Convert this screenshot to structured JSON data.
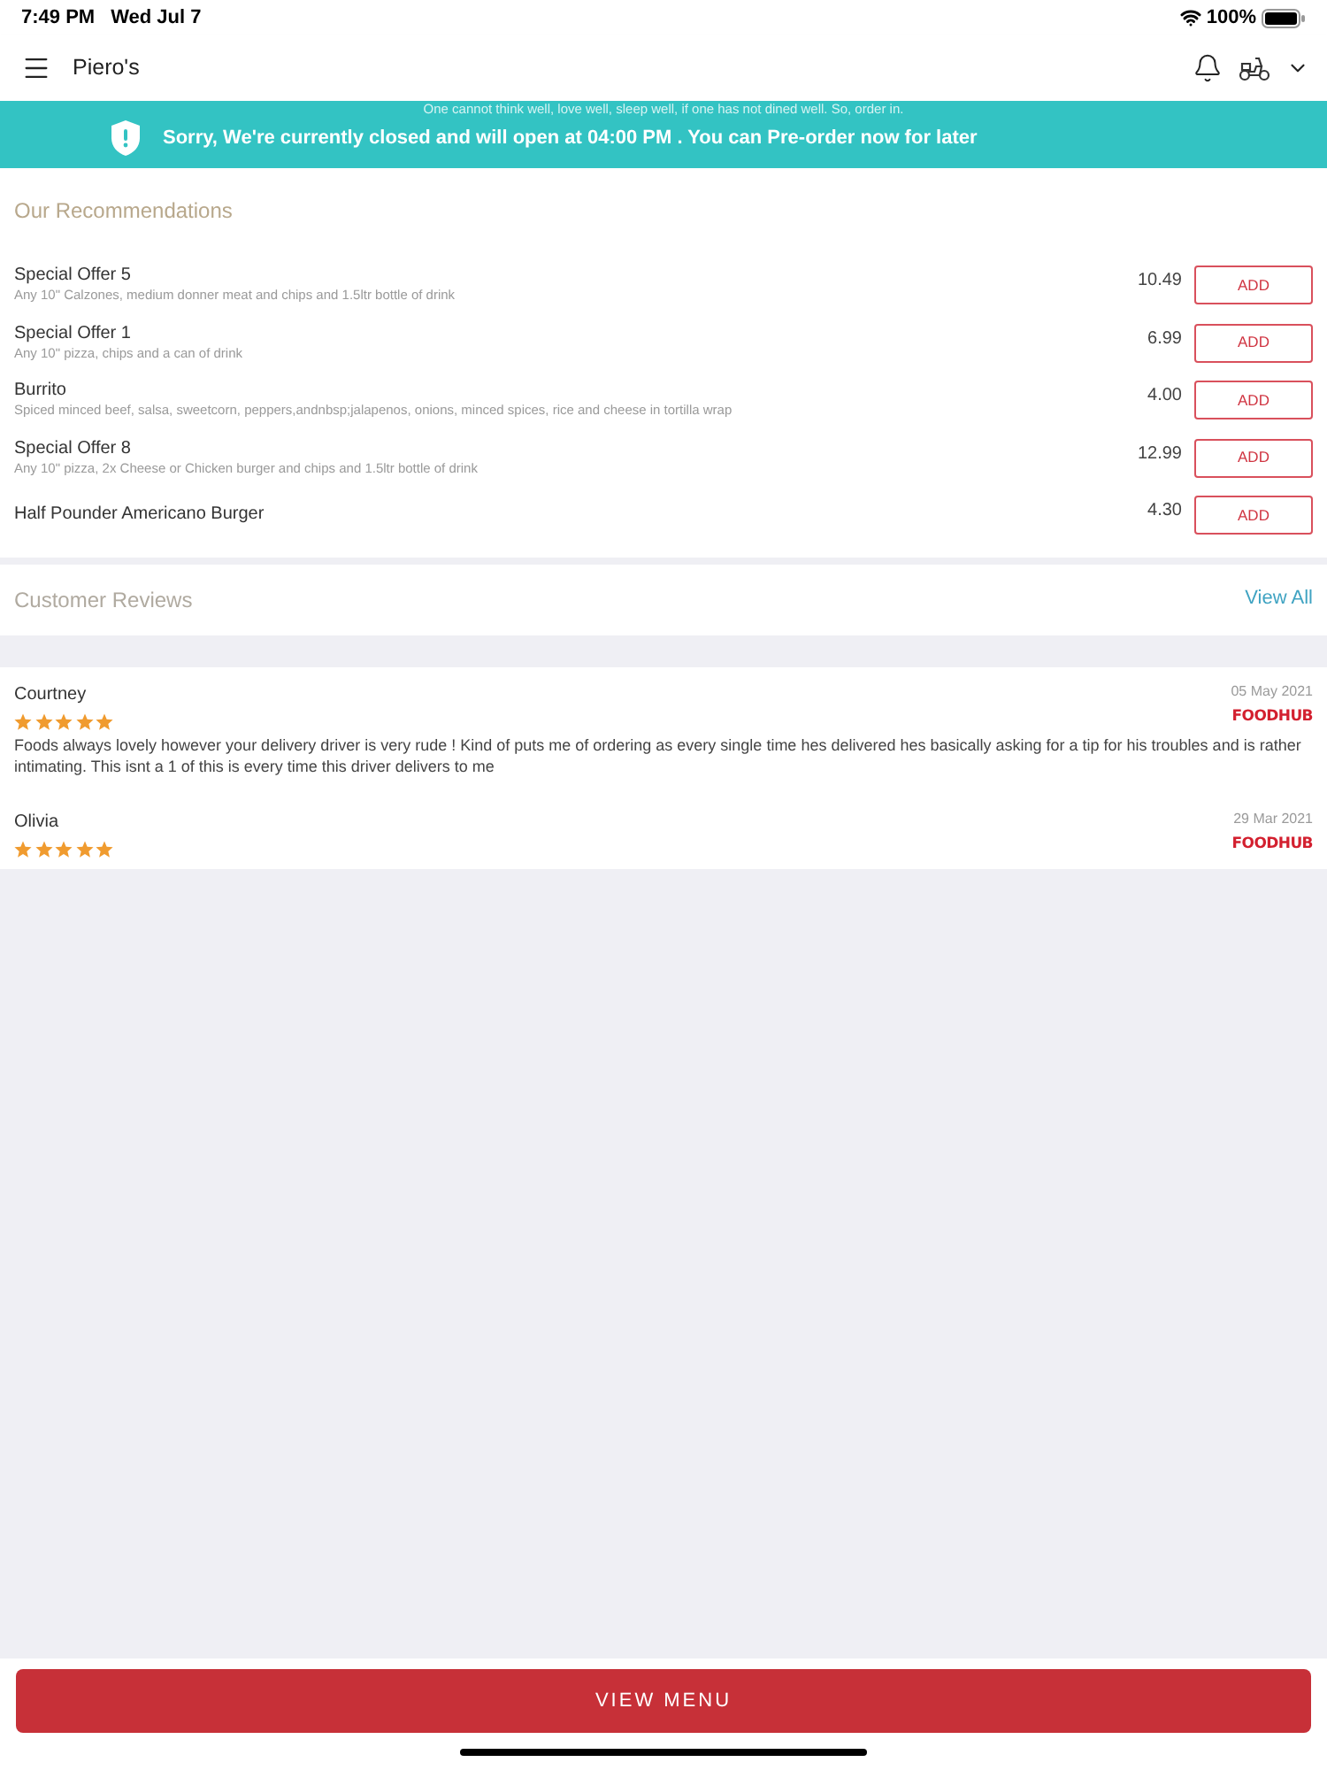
{
  "status_bar": {
    "time": "7:49 PM",
    "date": "Wed Jul 7",
    "battery": "100%"
  },
  "header": {
    "title": "Piero's"
  },
  "banner": {
    "tagline": "One cannot think well, love well, sleep well, if one has not dined well. So, order in.",
    "message": "Sorry, We're currently closed and will open at 04:00 PM . You can Pre-order now for later"
  },
  "recommendations": {
    "title": "Our Recommendations",
    "items": [
      {
        "name": "Special Offer 5",
        "description": "Any 10\" Calzones, medium donner meat and chips and 1.5ltr bottle of drink",
        "price": "10.49",
        "button": "ADD"
      },
      {
        "name": "Special Offer 1",
        "description": "Any 10\" pizza, chips and a can of drink",
        "price": "6.99",
        "button": "ADD"
      },
      {
        "name": "Burrito",
        "description": "Spiced minced beef, salsa, sweetcorn, peppers,andnbsp;jalapenos, onions, minced spices, rice and cheese in tortilla wrap",
        "price": "4.00",
        "button": "ADD"
      },
      {
        "name": "Special Offer 8",
        "description": "Any 10\" pizza, 2x Cheese or Chicken burger and chips and 1.5ltr bottle of drink",
        "price": "12.99",
        "button": "ADD"
      },
      {
        "name": "Half Pounder Americano Burger",
        "price": "4.30",
        "button": "ADD"
      }
    ]
  },
  "reviews": {
    "title": "Customer Reviews",
    "link": "View All",
    "items": [
      {
        "author": "Courtney",
        "stars": 5,
        "date": "05 May 2021",
        "source": "FOODHUB",
        "text": "Foods always lovely however your delivery driver is very rude !  Kind of puts me of ordering as every single time hes delivered hes basically asking for a tip for his troubles and is rather intimating. This isnt a 1 of this is every time this driver delivers to me"
      },
      {
        "author": "Olivia",
        "stars": 5,
        "date": "29 Mar 2021",
        "source": "FOODHUB"
      }
    ]
  },
  "footer_button": "VIEW MENU"
}
